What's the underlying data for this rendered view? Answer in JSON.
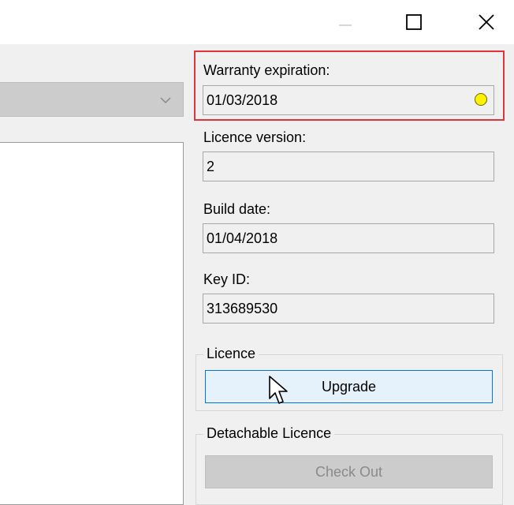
{
  "titlebar": {
    "minimize_icon": "minimize-icon",
    "maximize_icon": "maximize-icon",
    "close_icon": "close-icon"
  },
  "left": {
    "dropdown": {
      "value": "",
      "icon": "chevron-down-icon"
    }
  },
  "fields": {
    "warranty": {
      "label": "Warranty expiration:",
      "value": "01/03/2018",
      "status_color": "#fff200",
      "status_icon": "status-dot-icon"
    },
    "licence_version": {
      "label": "Licence version:",
      "value": "2"
    },
    "build_date": {
      "label": "Build date:",
      "value": "01/04/2018"
    },
    "key_id": {
      "label": "Key ID:",
      "value": "313689530"
    }
  },
  "licence_group": {
    "title": "Licence",
    "button_label": "Upgrade"
  },
  "detachable_group": {
    "title": "Detachable Licence",
    "button_label": "Check Out"
  },
  "colors": {
    "highlight_border": "#e0343c",
    "button_accent": "#0078d7"
  },
  "cursor": {
    "icon": "mouse-pointer-icon"
  }
}
